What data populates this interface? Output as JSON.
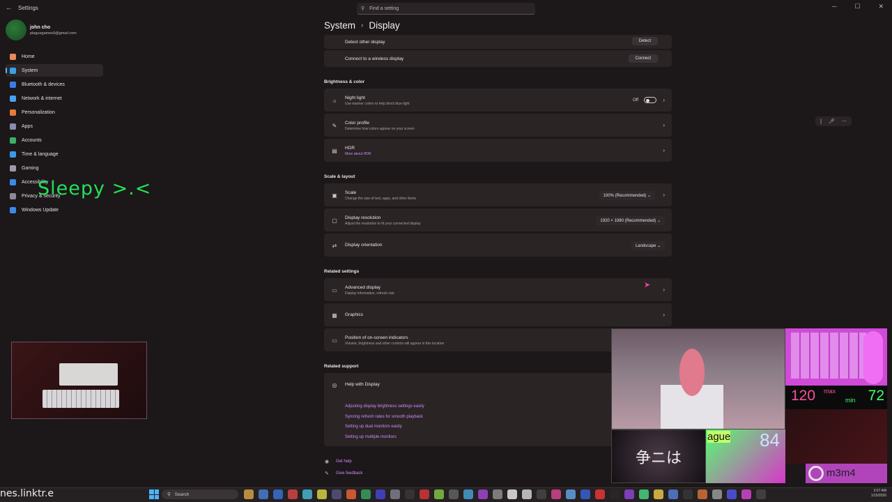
{
  "window": {
    "title": "Settings",
    "back": "←",
    "minimize": "─",
    "maximize": "☐",
    "close": "✕"
  },
  "search": {
    "placeholder": "Find a setting"
  },
  "user": {
    "name": "john cho",
    "email": "plaguegames9@gmail.com"
  },
  "sidebar": {
    "items": [
      {
        "label": "Home",
        "color": "#e88a5a"
      },
      {
        "label": "System",
        "color": "#3aa0e8"
      },
      {
        "label": "Bluetooth & devices",
        "color": "#3a7be8"
      },
      {
        "label": "Network & internet",
        "color": "#4aa0f0"
      },
      {
        "label": "Personalization",
        "color": "#e87a3a"
      },
      {
        "label": "Apps",
        "color": "#8a8ab0"
      },
      {
        "label": "Accounts",
        "color": "#3ab06a"
      },
      {
        "label": "Time & language",
        "color": "#3a9ae8"
      },
      {
        "label": "Gaming",
        "color": "#9a9aa8"
      },
      {
        "label": "Accessibility",
        "color": "#3a8ae8"
      },
      {
        "label": "Privacy & security",
        "color": "#8a8a9a"
      },
      {
        "label": "Windows Update",
        "color": "#3a8ae8"
      }
    ]
  },
  "overlay": {
    "sleepy": "Sleepy >.<"
  },
  "header": {
    "section": "System",
    "page": "Display"
  },
  "rows": {
    "detect": {
      "title": "Detect other display",
      "button": "Detect"
    },
    "wireless": {
      "title": "Connect to a wireless display",
      "button": "Connect"
    }
  },
  "brightness": {
    "heading": "Brightness & color",
    "night_light": {
      "title": "Night light",
      "sub": "Use warmer colors to help block blue light",
      "state": "Off"
    },
    "color_profile": {
      "title": "Color profile",
      "sub": "Determine how colors appear on your screen"
    },
    "hdr": {
      "title": "HDR",
      "link": "More about HDR"
    }
  },
  "scale": {
    "heading": "Scale & layout",
    "scale": {
      "title": "Scale",
      "sub": "Change the size of text, apps, and other items",
      "value": "100% (Recommended)"
    },
    "resolution": {
      "title": "Display resolution",
      "sub": "Adjust the resolution to fit your connected display",
      "value": "1920 × 1080 (Recommended)"
    },
    "orientation": {
      "title": "Display orientation",
      "value": "Landscape"
    }
  },
  "related": {
    "heading": "Related settings",
    "advanced": {
      "title": "Advanced display",
      "sub": "Display information, refresh rate"
    },
    "graphics": {
      "title": "Graphics"
    },
    "osd": {
      "title": "Position of on-screen indicators",
      "sub": "Volume, brightness and other controls will appear in this location"
    }
  },
  "support": {
    "heading": "Related support",
    "help": {
      "title": "Help with Display"
    },
    "links": [
      "Adjusting display brightness settings easily",
      "Syncing refresh rates for smooth playback",
      "Setting up dual monitors easily",
      "Setting up multiple monitors"
    ]
  },
  "footer": {
    "get_help": "Get help",
    "feedback": "Give feedback"
  },
  "stream": {
    "max_val": "120",
    "max_label": "max",
    "min_label": "min",
    "min_val": "72",
    "tag": "ague",
    "num": "84",
    "name": "m3m4",
    "glyph": "争ニは"
  },
  "taskbar": {
    "links": "nes.linktr.e",
    "search": "Search",
    "clock_time": "3:07 AM",
    "clock_date": "1/15/2026"
  }
}
